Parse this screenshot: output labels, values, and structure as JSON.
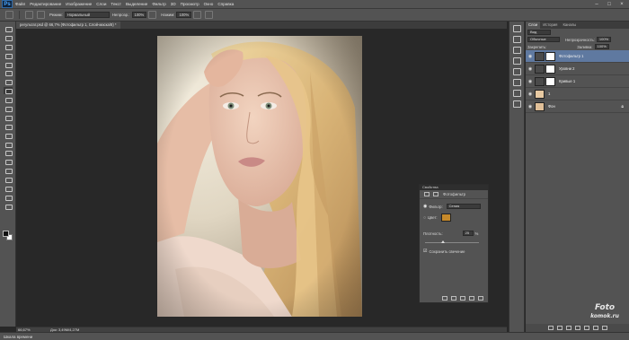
{
  "app": {
    "logo": "Ps"
  },
  "menu": [
    "Файл",
    "Редактирование",
    "Изображение",
    "Слои",
    "Текст",
    "Выделение",
    "Фильтр",
    "3D",
    "Просмотр",
    "Окно",
    "Справка"
  ],
  "window_controls": [
    "–",
    "□",
    "×"
  ],
  "options": {
    "mode_label": "Режим:",
    "mode_value": "Нормальный",
    "opacity_label": "Непрозр.:",
    "opacity_value": "100%",
    "flow_label": "Нажим:",
    "flow_value": "100%"
  },
  "document": {
    "tab_title": "регультат.psd @ 66,7% (Фотофильтр 1, Слой-маска/8) *",
    "zoom": "66,67%",
    "size_info": "Док: 3,49M/4,27M"
  },
  "timeline_label": "Шкала времени",
  "layers_panel": {
    "tabs": [
      "Слои",
      "История",
      "Каналы"
    ],
    "kind_label": "Вид",
    "blend_mode": "Обычные",
    "opacity_label": "Непрозрачность:",
    "opacity_value": "100%",
    "lock_label": "Закрепить:",
    "fill_label": "Заливка:",
    "fill_value": "100%",
    "layers": [
      {
        "name": "Фотофильтр 1",
        "selected": true,
        "thumb_color": "#d8d8d8",
        "mask": true
      },
      {
        "name": "Уровни 2",
        "selected": false,
        "thumb_color": "#cfcfcf",
        "mask": true
      },
      {
        "name": "Кривые 1",
        "selected": false,
        "thumb_color": "#cfcfcf",
        "mask": true
      },
      {
        "name": "1",
        "selected": false,
        "thumb_color": "#e7c9a2",
        "mask": false
      },
      {
        "name": "Фон",
        "selected": false,
        "thumb_color": "#e0bf98",
        "mask": false
      }
    ]
  },
  "properties_panel": {
    "title": "Свойства",
    "header": "Фотофильтр",
    "filter_label": "Фильтр:",
    "filter_value": "Сепия",
    "color_label": "Цвет:",
    "color_value": "#c6892a",
    "density_label": "Плотность:",
    "density_value": "25",
    "density_unit": "%",
    "preserve_label": "Сохранить свечение"
  },
  "watermark": {
    "line1": "Foto",
    "line2": "komok.ru"
  }
}
